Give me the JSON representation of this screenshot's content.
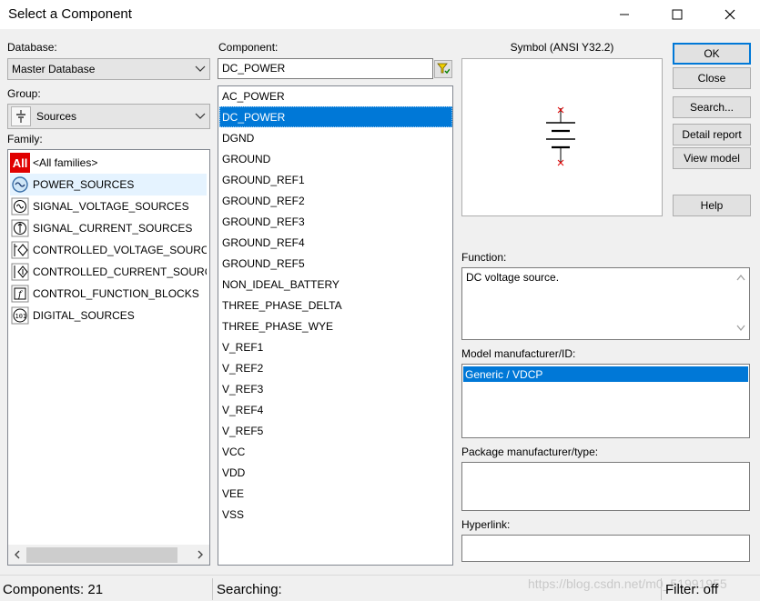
{
  "window": {
    "title": "Select a Component",
    "minimize_icon": "minimize-icon",
    "maximize_icon": "maximize-icon",
    "close_icon": "close-icon"
  },
  "database": {
    "label": "Database:",
    "value": "Master Database"
  },
  "group": {
    "label": "Group:",
    "value": "Sources",
    "icon": "sources-icon"
  },
  "family": {
    "label": "Family:",
    "items": [
      {
        "label": "<All families>",
        "icon": "all-families-icon"
      },
      {
        "label": "POWER_SOURCES",
        "icon": "power-sources-icon"
      },
      {
        "label": "SIGNAL_VOLTAGE_SOURCES",
        "icon": "signal-voltage-icon"
      },
      {
        "label": "SIGNAL_CURRENT_SOURCES",
        "icon": "signal-current-icon"
      },
      {
        "label": "CONTROLLED_VOLTAGE_SOURCES",
        "icon": "controlled-voltage-icon"
      },
      {
        "label": "CONTROLLED_CURRENT_SOURCES",
        "icon": "controlled-current-icon"
      },
      {
        "label": "CONTROL_FUNCTION_BLOCKS",
        "icon": "control-function-icon"
      },
      {
        "label": "DIGITAL_SOURCES",
        "icon": "digital-sources-icon"
      }
    ],
    "all_icon_text": "All"
  },
  "component": {
    "label": "Component:",
    "search_value": "DC_POWER",
    "filter_icon": "filter-icon",
    "items": [
      "AC_POWER",
      "DC_POWER",
      "DGND",
      "GROUND",
      "GROUND_REF1",
      "GROUND_REF2",
      "GROUND_REF3",
      "GROUND_REF4",
      "GROUND_REF5",
      "NON_IDEAL_BATTERY",
      "THREE_PHASE_DELTA",
      "THREE_PHASE_WYE",
      "V_REF1",
      "V_REF2",
      "V_REF3",
      "V_REF4",
      "V_REF5",
      "VCC",
      "VDD",
      "VEE",
      "VSS"
    ],
    "selected": "DC_POWER"
  },
  "symbol": {
    "label": "Symbol (ANSI Y32.2)",
    "icon": "dc-source-symbol-icon"
  },
  "function": {
    "label": "Function:",
    "value": "DC voltage source."
  },
  "model": {
    "label": "Model manufacturer/ID:",
    "items": [
      "Generic / VDCP"
    ]
  },
  "package": {
    "label": "Package manufacturer/type:",
    "value": ""
  },
  "hyperlink": {
    "label": "Hyperlink:",
    "value": ""
  },
  "buttons": {
    "ok": "OK",
    "close": "Close",
    "search": "Search...",
    "detail_report": "Detail report",
    "view_model": "View model",
    "help": "Help"
  },
  "status": {
    "components": "Components: 21",
    "searching": "Searching:",
    "filter": "Filter: off",
    "watermark": "https://blog.csdn.net/m0_51991955"
  },
  "colors": {
    "selection": "#0078d7",
    "hover": "#e5f3ff",
    "window_bg": "#f0f0f0"
  }
}
